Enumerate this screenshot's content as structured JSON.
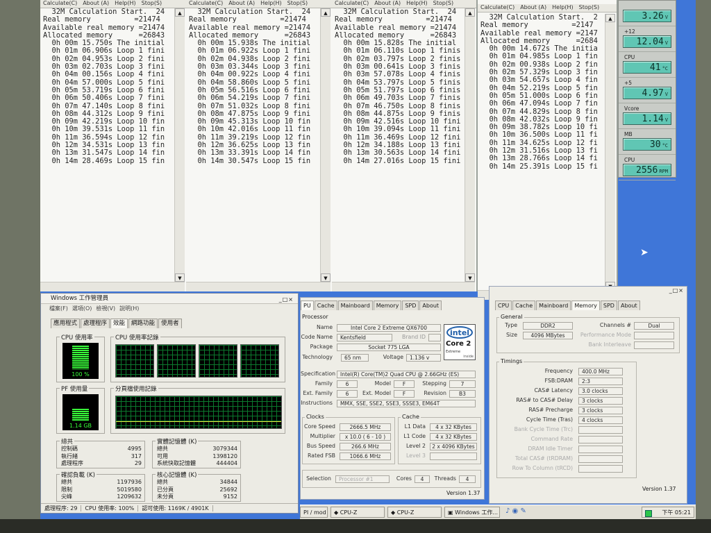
{
  "superpi": {
    "menu": [
      "Calculate(C)",
      "About (A)",
      "Help(H)",
      "Stop(S)"
    ],
    "windows": [
      {
        "lines": [
          "  32M Calculation Start.  24",
          "Real memory          =21474",
          "Available real memory =21474",
          "Allocated memory      =26843",
          "  0h 00m 15.750s The initial",
          "  0h 01m 06.906s Loop 1 fini",
          "  0h 02m 04.953s Loop 2 fini",
          "  0h 03m 02.703s Loop 3 fini",
          "  0h 04m 00.156s Loop 4 fini",
          "  0h 04m 57.000s Loop 5 fini",
          "  0h 05m 53.719s Loop 6 fini",
          "  0h 06m 50.406s Loop 7 fini",
          "  0h 07m 47.140s Loop 8 fini",
          "  0h 08m 44.312s Loop 9 fini",
          "  0h 09m 42.219s Loop 10 fin",
          "  0h 10m 39.531s Loop 11 fin",
          "  0h 11m 36.594s Loop 12 fin",
          "  0h 12m 34.531s Loop 13 fin",
          "  0h 13m 31.547s Loop 14 fin",
          "  0h 14m 28.469s Loop 15 fin"
        ]
      },
      {
        "lines": [
          "  32M Calculation Start.  24",
          "Real memory          =21474",
          "Available real memory =21474",
          "Allocated memory      =26843",
          "  0h 00m 15.938s The initial",
          "  0h 01m 06.922s Loop 1 fini",
          "  0h 02m 04.938s Loop 2 fini",
          "  0h 03m 03.344s Loop 3 fini",
          "  0h 04m 00.922s Loop 4 fini",
          "  0h 04m 58.860s Loop 5 fini",
          "  0h 05m 56.516s Loop 6 fini",
          "  0h 06m 54.219s Loop 7 fini",
          "  0h 07m 51.032s Loop 8 fini",
          "  0h 08m 47.875s Loop 9 fini",
          "  0h 09m 45.313s Loop 10 fin",
          "  0h 10m 42.016s Loop 11 fin",
          "  0h 11m 39.219s Loop 12 fin",
          "  0h 12m 36.625s Loop 13 fin",
          "  0h 13m 33.391s Loop 14 fin",
          "  0h 14m 30.547s Loop 15 fin"
        ]
      },
      {
        "lines": [
          "  32M Calculation Start.  24",
          "Real memory          =21474",
          "Available real memory =21474",
          "Allocated memory      =26843",
          "  0h 00m 15.828s The initial",
          "  0h 01m 06.110s Loop 1 finis",
          "  0h 02m 03.797s Loop 2 finis",
          "  0h 03m 00.641s Loop 3 finis",
          "  0h 03m 57.078s Loop 4 finis",
          "  0h 04m 53.797s Loop 5 finis",
          "  0h 05m 51.797s Loop 6 finis",
          "  0h 06m 49.703s Loop 7 finis",
          "  0h 07m 46.750s Loop 8 finis",
          "  0h 08m 44.875s Loop 9 finis",
          "  0h 09m 42.516s Loop 10 fini",
          "  0h 10m 39.094s Loop 11 fini",
          "  0h 11m 36.469s Loop 12 fini",
          "  0h 12m 34.188s Loop 13 fini",
          "  0h 13m 30.563s Loop 14 fini",
          "  0h 14m 27.016s Loop 15 fini"
        ]
      },
      {
        "lines": [
          "  32M Calculation Start.  2",
          "Real memory          =2147",
          "Available real memory =2147",
          "Allocated memory      =2684",
          "  0h 00m 14.672s The initia",
          "  0h 01m 04.985s Loop 1 fin",
          "  0h 02m 00.938s Loop 2 fin",
          "  0h 02m 57.329s Loop 3 fin",
          "  0h 03m 54.657s Loop 4 fin",
          "  0h 04m 52.219s Loop 5 fin",
          "  0h 05m 51.000s Loop 6 fin",
          "  0h 06m 47.094s Loop 7 fin",
          "  0h 07m 44.829s Loop 8 fin",
          "  0h 08m 42.032s Loop 9 fin",
          "  0h 09m 38.782s Loop 10 fi",
          "  0h 10m 36.500s Loop 11 fi",
          "  0h 11m 34.625s Loop 12 fi",
          "  0h 12m 31.516s Loop 13 fi",
          "  0h 13m 28.766s Loop 14 fi",
          "  0h 14m 25.391s Loop 15 fi"
        ]
      }
    ]
  },
  "gadget": {
    "items": [
      {
        "label": "",
        "value": "3.26",
        "unit": "V"
      },
      {
        "label": "+12",
        "value": "12.04",
        "unit": "V"
      },
      {
        "label": "CPU",
        "value": "41",
        "unit": "°C"
      },
      {
        "label": "+5",
        "value": "4.97",
        "unit": "V"
      },
      {
        "label": "Vcore",
        "value": "1.14",
        "unit": "V"
      },
      {
        "label": "MB",
        "value": "30",
        "unit": "°C"
      },
      {
        "label": "CPU",
        "value": "2556",
        "unit": "RPM"
      }
    ]
  },
  "taskmgr": {
    "title": "Windows 工作管理員",
    "controls": "_□×",
    "menu": [
      "檔案(F)",
      "選項(O)",
      "檢視(V)",
      "說明(H)"
    ],
    "tabs": [
      "應用程式",
      "處理程序",
      "效能",
      "網路功能",
      "使用者"
    ],
    "cpu_usage_title": "CPU 使用率",
    "cpu_usage_value": "100 %",
    "cpu_usage_fraction": 1.0,
    "cpu_history_title": "CPU 使用率記錄",
    "pf_usage_title": "PF 使用量",
    "pf_usage_value": "1.14 GB",
    "pf_usage_fraction": 0.5,
    "pf_history_title": "分頁檔使用記錄",
    "totals": {
      "title": "總共",
      "rows": [
        [
          "控制碼",
          "4995"
        ],
        [
          "執行緒",
          "317"
        ],
        [
          "處理程序",
          "29"
        ]
      ]
    },
    "physical": {
      "title": "實體記憶體 (K)",
      "rows": [
        [
          "總共",
          "3079344"
        ],
        [
          "可用",
          "1398120"
        ],
        [
          "系統快取記憶體",
          "444404"
        ]
      ]
    },
    "commit": {
      "title": "確認負載 (K)",
      "rows": [
        [
          "總共",
          "1197936"
        ],
        [
          "限制",
          "5019580"
        ],
        [
          "尖峰",
          "1209632"
        ]
      ]
    },
    "kernel": {
      "title": "核心記憶體 (K)",
      "rows": [
        [
          "總共",
          "34844"
        ],
        [
          "已分頁",
          "25692"
        ],
        [
          "未分頁",
          "9152"
        ]
      ]
    },
    "status": [
      "處理程序: 29",
      "CPU 使用率: 100%",
      "認可使用: 1169K / 4901K"
    ]
  },
  "cpuz1": {
    "tabs": [
      "PU",
      "Cache",
      "Mainboard",
      "Memory",
      "SPD",
      "About"
    ],
    "processor_title": "Processor",
    "name_label": "Name",
    "name": "Intel Core 2 Extreme QX6700",
    "codename_label": "Code Name",
    "codename": "Kentsfield",
    "brandid_label": "Brand ID",
    "package_label": "Package",
    "package": "Socket 775 LGA",
    "technology_label": "Technology",
    "technology": "65 nm",
    "voltage_label": "Voltage",
    "voltage": "1.136 v",
    "spec_label": "Specification",
    "spec": "Intel(R) Core(TM)2 Quad CPU     @ 2.66GHz (ES)",
    "family_label": "Family",
    "family": "6",
    "model_label": "Model",
    "model": "F",
    "stepping_label": "Stepping",
    "stepping": "7",
    "extfamily_label": "Ext. Family",
    "extfamily": "6",
    "extmodel_label": "Ext. Model",
    "extmodel": "F",
    "revision_label": "Revision",
    "revision": "B3",
    "instructions_label": "Instructions",
    "instructions": "MMX, SSE, SSE2, SSE3, SSSE3, EM64T",
    "logo_intel": "intel",
    "logo_core": "Core 2",
    "logo_extreme": "Extreme",
    "logo_inside": "inside",
    "clocks_title": "Clocks",
    "corespeed_label": "Core Speed",
    "corespeed": "2666.5 MHz",
    "multiplier_label": "Multiplier",
    "multiplier": "x 10.0 ( 6 - 10 )",
    "busspeed_label": "Bus Speed",
    "busspeed": "266.6 MHz",
    "ratedfsb_label": "Rated FSB",
    "ratedfsb": "1066.6 MHz",
    "cache_title": "Cache",
    "l1data_label": "L1 Data",
    "l1data": "4 x 32 KBytes",
    "l1code_label": "L1 Code",
    "l1code": "4 x 32 KBytes",
    "level2_label": "Level 2",
    "level2": "2 x 4096 KBytes",
    "level3_label": "Level 3",
    "selection_label": "Selection",
    "selection": "Processor #1",
    "cores_label": "Cores",
    "cores": "4",
    "threads_label": "Threads",
    "threads": "4",
    "version": "Version 1.37"
  },
  "cpuz2": {
    "controls": "_□×",
    "tabs": [
      "CPU",
      "Cache",
      "Mainboard",
      "Memory",
      "SPD",
      "About"
    ],
    "general_title": "General",
    "type_label": "Type",
    "type": "DDR2",
    "size_label": "Size",
    "size": "4096 MBytes",
    "channels_label": "Channels #",
    "channels": "Dual",
    "perfmode_label": "Performance Mode",
    "bankinterleave_label": "Bank Interleave",
    "timings_title": "Timings",
    "timings": [
      {
        "label": "Frequency",
        "value": "400.0 MHz"
      },
      {
        "label": "FSB:DRAM",
        "value": "2:3"
      },
      {
        "label": "CAS# Latency",
        "value": "3.0 clocks"
      },
      {
        "label": "RAS# to CAS# Delay",
        "value": "3 clocks"
      },
      {
        "label": "RAS# Precharge",
        "value": "3 clocks"
      },
      {
        "label": "Cycle Time (Tras)",
        "value": "4 clocks"
      },
      {
        "label": "Bank Cycle Time (Trc)",
        "value": ""
      },
      {
        "label": "Command Rate",
        "value": ""
      },
      {
        "label": "DRAM Idle Timer",
        "value": ""
      },
      {
        "label": "Total CAS# (tRDRAM)",
        "value": ""
      },
      {
        "label": "Row To Column (tRCD)",
        "value": ""
      }
    ],
    "version": "Version 1.37"
  },
  "taskbar": {
    "buttons": [
      "PI / mod",
      "CPU-Z",
      "CPU-Z",
      "Windows 工作..."
    ],
    "clock": "下午 05:21"
  },
  "colors": {
    "desktop": "#3f76d8",
    "graph_green": "#39ff3a",
    "lcd": "#60c6b4"
  }
}
